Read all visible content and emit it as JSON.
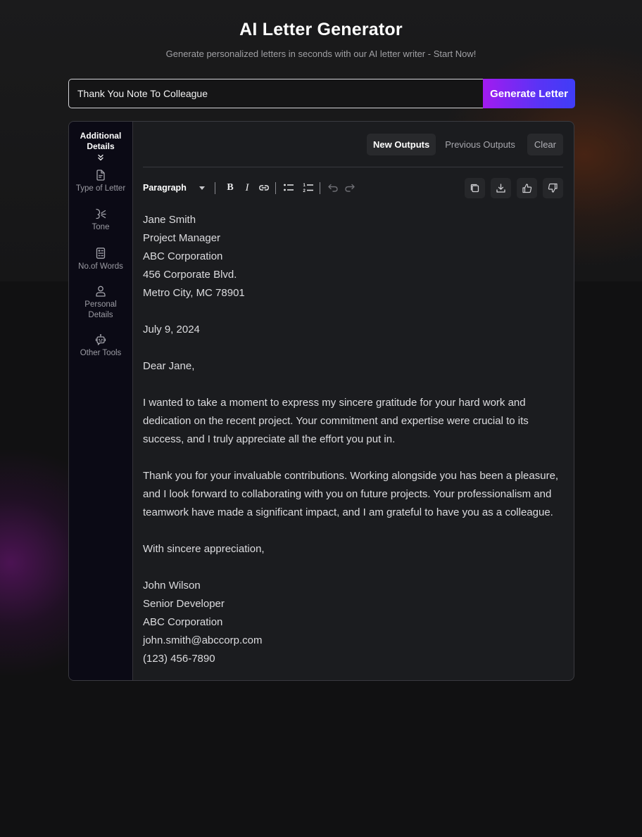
{
  "header": {
    "title": "AI Letter Generator",
    "subtitle": "Generate personalized letters in seconds with our AI letter writer - Start Now!"
  },
  "prompt": {
    "value": "Thank You Note To Colleague",
    "generate_label": "Generate Letter",
    "accent_gradient": [
      "#a21bf0",
      "#3f3df7"
    ]
  },
  "sidebar": {
    "heading_line1": "Additional",
    "heading_line2": "Details",
    "items": [
      {
        "label": "Type of Letter",
        "icon": "document-icon"
      },
      {
        "label": "Tone",
        "icon": "tone-icon"
      },
      {
        "label": "No.of Words",
        "icon": "word-count-icon"
      },
      {
        "label_line1": "Personal",
        "label_line2": "Details",
        "icon": "user-icon"
      },
      {
        "label": "Other Tools",
        "icon": "robot-icon"
      }
    ]
  },
  "tabs": {
    "new": "New Outputs",
    "previous": "Previous Outputs",
    "clear": "Clear",
    "active": "New Outputs"
  },
  "toolbar": {
    "block_type": "Paragraph",
    "bold": "B",
    "italic": "I",
    "actions": [
      "copy",
      "download",
      "thumbs-up",
      "thumbs-down"
    ]
  },
  "letter": {
    "recipient": [
      "Jane Smith",
      "Project Manager",
      "ABC Corporation",
      "456 Corporate Blvd.",
      "Metro City, MC 78901"
    ],
    "date": "July 9, 2024",
    "salutation": "Dear Jane,",
    "paragraphs": [
      [
        "I wanted to take a moment to express my sincere gratitude for your hard work and",
        "dedication on the recent project. Your commitment and expertise were crucial to its",
        "success, and I truly appreciate all the effort you put in."
      ],
      [
        "Thank you for your invaluable contributions. Working alongside you has been a pleasure,",
        "and I look forward to collaborating with you on future projects. Your professionalism and",
        "teamwork have made a significant impact, and I am grateful to have you as a colleague."
      ]
    ],
    "closing": "With sincere appreciation,",
    "signature": [
      "John Wilson",
      "Senior Developer",
      "ABC Corporation",
      "john.smith@abccorp.com",
      "(123) 456-7890"
    ]
  }
}
